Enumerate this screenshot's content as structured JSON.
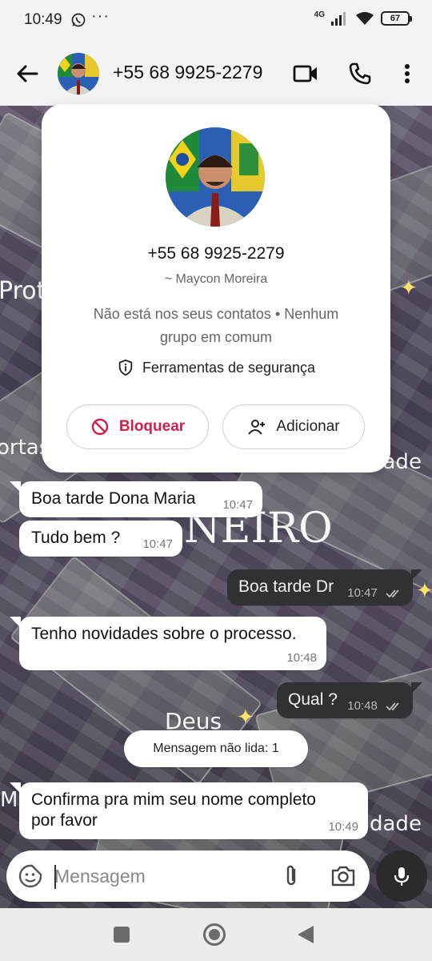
{
  "status_bar": {
    "time": "10:49",
    "more": "···",
    "network": "4G",
    "battery": "67"
  },
  "header": {
    "title": "+55 68 9925-2279"
  },
  "wallpaper": {
    "texts": [
      "Prot",
      "ortas",
      "NEIRO",
      "Deus",
      "dade",
      "dade",
      "M"
    ]
  },
  "contact_card": {
    "phone": "+55 68 9925-2279",
    "name": "~ Maycon Moreira",
    "info": "Não está nos seus contatos • Nenhum grupo em comum",
    "safety_tools": "Ferramentas de segurança",
    "block_label": "Bloquear",
    "add_label": "Adicionar"
  },
  "messages": [
    {
      "direction": "in",
      "text": "Boa tarde Dona Maria",
      "time": "10:47"
    },
    {
      "direction": "in",
      "text": "Tudo bem ?",
      "time": "10:47"
    },
    {
      "direction": "out",
      "text": "Boa tarde Dr",
      "time": "10:47",
      "status": "read"
    },
    {
      "direction": "in",
      "text": "Tenho novidades sobre o processo.",
      "time": "10:48"
    },
    {
      "direction": "out",
      "text": "Qual ?",
      "time": "10:48",
      "status": "read"
    },
    {
      "direction": "in",
      "text": "Confirma pra mim seu nome completo por favor",
      "time": "10:49"
    }
  ],
  "unread_divider": "Mensagem não lida: 1",
  "composer": {
    "placeholder": "Mensagem"
  },
  "colors": {
    "block_red": "#d2204d",
    "outgoing_bubble": "#303134",
    "incoming_bubble": "#ffffff"
  }
}
